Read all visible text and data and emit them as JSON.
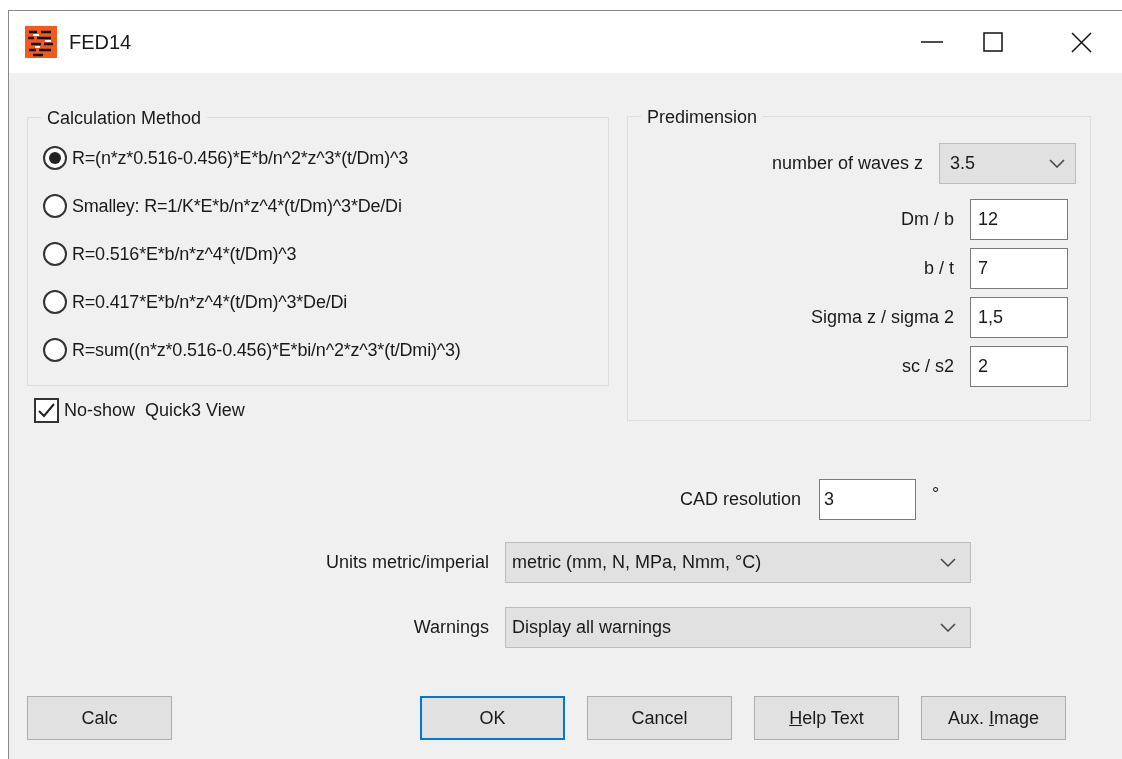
{
  "window": {
    "title": "FED14"
  },
  "calculation_method": {
    "legend": "Calculation Method",
    "options": [
      {
        "label": "R=(n*z*0.516-0.456)*E*b/n^2*z^3*(t/Dm)^3",
        "selected": true
      },
      {
        "label": "Smalley: R=1/K*E*b/n*z^4*(t/Dm)^3*De/Di",
        "selected": false
      },
      {
        "label": "R=0.516*E*b/n*z^4*(t/Dm)^3",
        "selected": false
      },
      {
        "label": "R=0.417*E*b/n*z^4*(t/Dm)^3*De/Di",
        "selected": false
      },
      {
        "label": "R=sum((n*z*0.516-0.456)*E*bi/n^2*z^3*(t/Dmi)^3)",
        "selected": false
      }
    ]
  },
  "no_show_checkbox": {
    "label": "No-show  Quick3 View",
    "checked": true
  },
  "predimension": {
    "legend": "Predimension",
    "waves": {
      "label": "number of waves z",
      "value": "3.5"
    },
    "fields": [
      {
        "label": "Dm / b",
        "value": "12"
      },
      {
        "label": "b / t",
        "value": "7"
      },
      {
        "label": "Sigma z / sigma 2",
        "value": "1,5"
      },
      {
        "label": "sc / s2",
        "value": "2"
      }
    ]
  },
  "cad_resolution": {
    "label": "CAD resolution",
    "value": "3",
    "unit": "°"
  },
  "units": {
    "label": "Units metric/imperial",
    "value": "metric (mm, N, MPa, Nmm, °C)"
  },
  "warnings": {
    "label": "Warnings",
    "value": "Display all warnings"
  },
  "buttons": [
    {
      "before": "Calc",
      "default": false
    },
    {
      "before": "OK",
      "default": true
    },
    {
      "before": "Cancel",
      "default": false
    },
    {
      "key": "H",
      "after": "elp Text",
      "default": false
    },
    {
      "before": "Aux. ",
      "key": "I",
      "after": "mage",
      "default": false
    }
  ]
}
